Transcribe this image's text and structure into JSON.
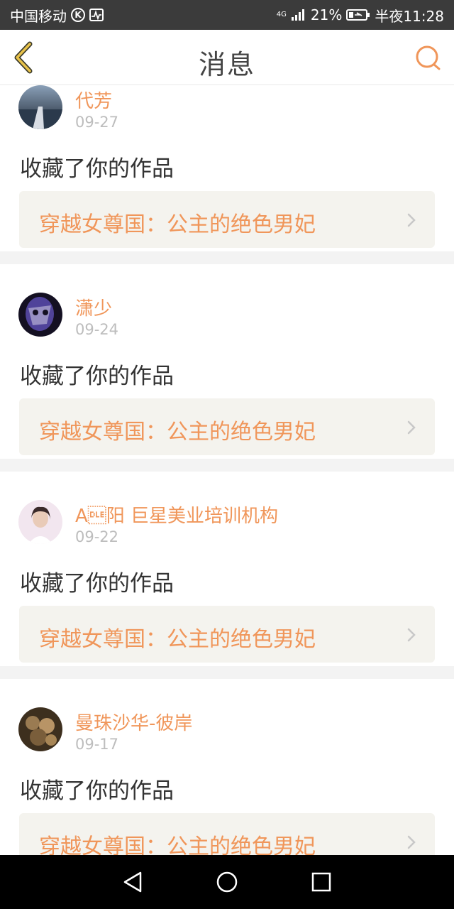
{
  "status_bar": {
    "carrier": "中国移动",
    "carrier_badge": "K",
    "network": "4G",
    "battery": "21%",
    "time": "半夜11:28",
    "icons": [
      "k-circle-icon",
      "pulse-icon",
      "signal-icon",
      "battery-icon"
    ]
  },
  "header": {
    "title": "消息",
    "back_icon": "chevron-left-icon",
    "search_icon": "search-icon",
    "accent_color": "#f0965a"
  },
  "messages": [
    {
      "name": "代芳",
      "date": "09-27",
      "action": "收藏了你的作品",
      "work": "穿越女尊国：公主的绝色男妃",
      "avatar_colors": [
        "#7a8fa8",
        "#1c2430"
      ]
    },
    {
      "name": "潇少",
      "date": "09-24",
      "action": "收藏了你的作品",
      "work": "穿越女尊国：公主的绝色男妃",
      "avatar_colors": [
        "#6a5acd",
        "#141022"
      ]
    },
    {
      "name": "A\u0010阳 巨星美业培训机构",
      "date": "09-22",
      "action": "收藏了你的作品",
      "work": "穿越女尊国：公主的绝色男妃",
      "avatar_colors": [
        "#f2e6ef",
        "#3a2a2a"
      ]
    },
    {
      "name": "曼珠沙华-彼岸",
      "date": "09-17",
      "action": "收藏了你的作品",
      "work": "穿越女尊国：公主的绝色男妃",
      "avatar_colors": [
        "#9a7b52",
        "#3d2f1e"
      ]
    }
  ],
  "nav": {
    "back": "triangle-back-icon",
    "home": "circle-home-icon",
    "recents": "square-recents-icon"
  }
}
